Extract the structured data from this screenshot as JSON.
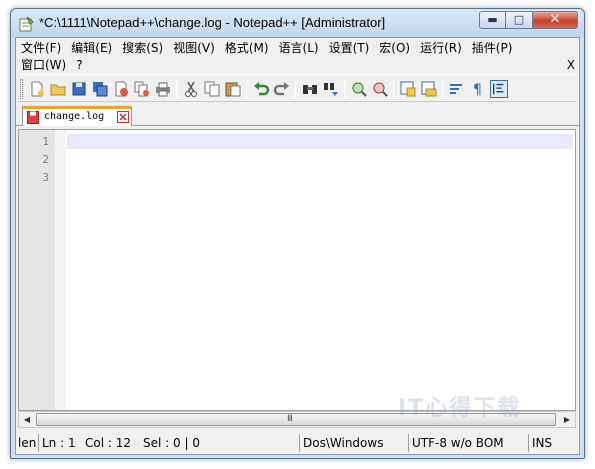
{
  "window": {
    "title": "*C:\\1111\\Notepad++\\change.log - Notepad++ [Administrator]",
    "caption_buttons": {
      "minimize": "▬",
      "maximize": "□",
      "close": "✕"
    }
  },
  "menu": {
    "row1": [
      "文件(F)",
      "编辑(E)",
      "搜索(S)",
      "视图(V)",
      "格式(M)",
      "语言(L)",
      "设置(T)",
      "宏(O)",
      "运行(R)",
      "插件(P)"
    ],
    "row2": [
      "窗口(W)",
      "?"
    ],
    "close_doc": "X"
  },
  "toolbar": {
    "icons": [
      "new-file",
      "open-file",
      "save",
      "save-all",
      "close",
      "close-all",
      "print",
      "cut",
      "copy",
      "paste",
      "undo",
      "redo",
      "find",
      "replace",
      "zoom-in",
      "zoom-out",
      "sync-vertical",
      "sync-horizontal",
      "word-wrap",
      "show-all-characters",
      "indent-guide"
    ]
  },
  "tabs": [
    {
      "label": "change.log",
      "modified": true
    }
  ],
  "editor": {
    "line_numbers": [
      "1",
      "2",
      "3"
    ],
    "current_line": 1,
    "current_line_color": "#e8e8ff"
  },
  "scrollbar": {
    "grip": "III"
  },
  "status": {
    "length": "len",
    "line": "Ln : 1",
    "col": "Col : 12",
    "sel": "Sel : 0 | 0",
    "eol": "Dos\\Windows",
    "encoding": "UTF-8 w/o BOM",
    "mode": "INS"
  },
  "watermark": "IT心得下载"
}
